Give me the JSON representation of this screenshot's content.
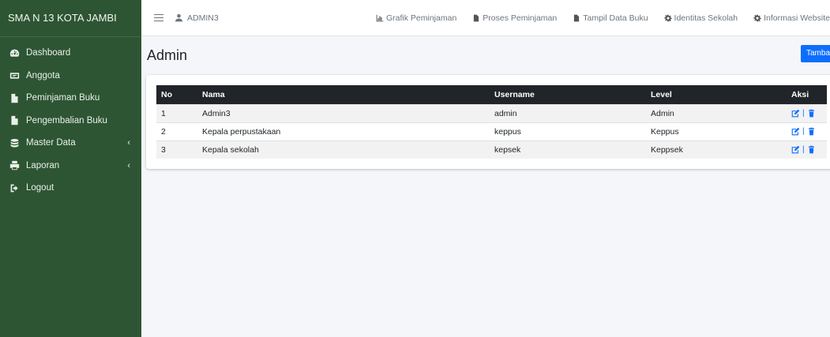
{
  "sidebar": {
    "brand": "SMA N 13 KOTA JAMBI",
    "items": [
      {
        "label": "Dashboard",
        "icon": "tachometer-icon"
      },
      {
        "label": "Anggota",
        "icon": "id-card-icon"
      },
      {
        "label": "Peminjaman Buku",
        "icon": "file-icon"
      },
      {
        "label": "Pengembalian Buku",
        "icon": "file-icon"
      },
      {
        "label": "Master Data",
        "icon": "database-icon",
        "chevron": "‹"
      },
      {
        "label": "Laporan",
        "icon": "print-icon",
        "chevron": "‹"
      },
      {
        "label": "Logout",
        "icon": "sign-out-icon"
      }
    ]
  },
  "topbar": {
    "user": "ADMIN3",
    "links": [
      {
        "label": "Grafik Peminjaman",
        "icon": "chart-icon"
      },
      {
        "label": "Proses Peminjaman",
        "icon": "file-icon"
      },
      {
        "label": "Tampil Data Buku",
        "icon": "file-icon"
      },
      {
        "label": "Identitas Sekolah",
        "icon": "cog-icon"
      },
      {
        "label": "Informasi Website",
        "icon": "cog-icon"
      }
    ]
  },
  "main": {
    "title": "Admin",
    "add_button": "Tambah",
    "table": {
      "headers": [
        "No",
        "Nama",
        "Username",
        "Level",
        "Aksi"
      ],
      "rows": [
        [
          "1",
          "Admin3",
          "admin",
          "Admin"
        ],
        [
          "2",
          "Kepala perpustakaan",
          "keppus",
          "Keppus"
        ],
        [
          "3",
          "Kepala sekolah",
          "kepsek",
          "Keppsek"
        ]
      ]
    }
  },
  "colors": {
    "sidebar": "#2d5533",
    "accent": "#0d6efd",
    "table_header": "#212529"
  }
}
